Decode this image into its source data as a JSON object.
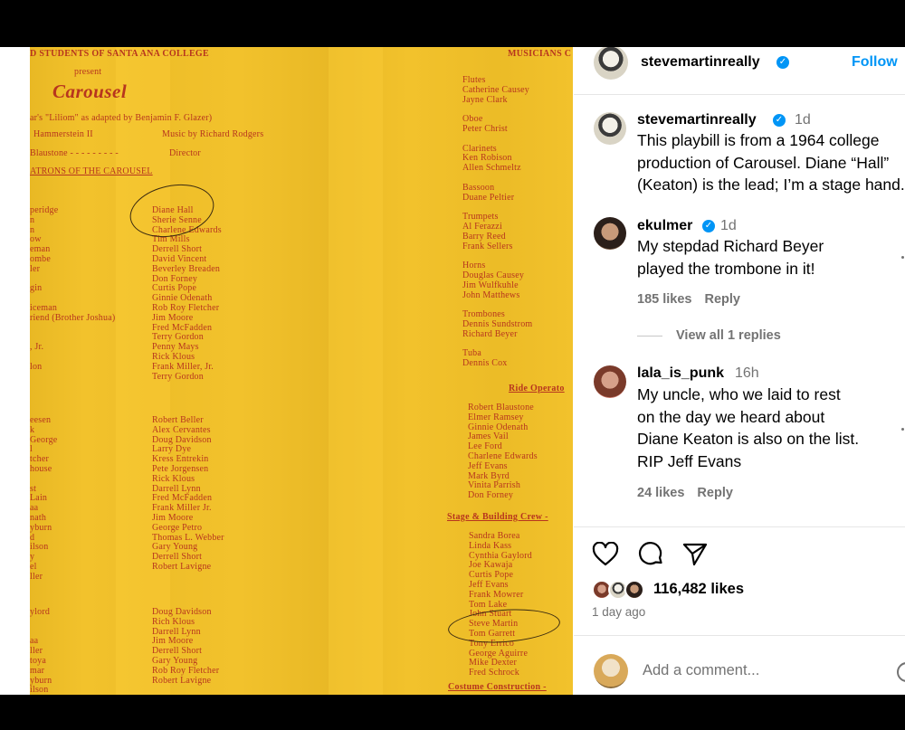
{
  "playbill": {
    "header_left": "D STUDENTS OF SANTA ANA COLLEGE",
    "header_right": "MUSICIANS C",
    "present": "present",
    "title": "Carousel",
    "credit1": "ar's \"Liliom\" as adapted by Benjamin F. Glazer)",
    "credit2a": "Hammerstein II",
    "credit2b": "Music by Richard Rodgers",
    "credit3a": "Blaustone - - - - - - - - -",
    "credit3b": "Director",
    "patrons_heading": "ATRONS OF THE CAROUSEL",
    "roles_left": [
      "peridge",
      "n",
      "n",
      "ow",
      "eman",
      "ombe",
      "ler",
      "",
      "gin",
      "",
      "iceman",
      "riend (Brother Joshua)",
      "",
      "",
      ", Jr.",
      "",
      "lon"
    ],
    "cast1": [
      "Diane Hall",
      "Sherie Senne",
      "Charlene Edwards",
      "Tim Mills",
      "Derrell Short",
      "David Vincent",
      "Beverley Breaden",
      "Don Forney",
      "Curtis Pope",
      "Ginnie Odenath",
      "Rob Roy Fletcher",
      "Jim Moore",
      "Fred McFadden",
      "Terry Gordon",
      "Penny Mays",
      "Rick Klous",
      "Frank Miller, Jr.",
      "Terry Gordon"
    ],
    "roles_left2": [
      "eesen",
      "k",
      "George",
      "l",
      "tcher",
      "house",
      "",
      "st",
      "Lain",
      "aa",
      "nath",
      "yburn",
      "d",
      "ilson",
      "y",
      "el",
      "ller"
    ],
    "cast2": [
      "Robert Beller",
      "Alex Cervantes",
      "Doug Davidson",
      "Larry Dye",
      "Kress Entrekin",
      "Pete Jorgensen",
      "Rick Klous",
      "Darrell Lynn",
      "Fred McFadden",
      "Frank Miller Jr.",
      "Jim Moore",
      "George Petro",
      "Thomas L. Webber",
      "Gary Young",
      "Derrell Short",
      "Robert Lavigne"
    ],
    "roles_left3": [
      "ylord",
      "",
      "",
      "aa",
      "ller",
      "toya",
      "mar",
      "yburn",
      "ilson"
    ],
    "cast3": [
      "Doug Davidson",
      "Rich Klous",
      "Darrell Lynn",
      "Jim Moore",
      "Derrell Short",
      "Gary Young",
      "Rob Roy Fletcher",
      "Robert Lavigne"
    ],
    "musicians": [
      "Flutes",
      "  Catherine Causey",
      "  Jayne Clark",
      "",
      "Oboe",
      "  Peter Christ",
      "",
      "Clarinets",
      "  Ken Robison",
      "  Allen Schmeltz",
      "",
      "Bassoon",
      "  Duane Peltier",
      "",
      "Trumpets",
      "  Al Ferazzi",
      "  Barry Reed",
      "  Frank Sellers",
      "",
      "Horns",
      "  Douglas Causey",
      "  Jim Wulfkuhle",
      "  John Matthews",
      "",
      "Trombones",
      "  Dennis Sundstrom",
      "  Richard Beyer",
      "",
      "Tuba",
      "  Dennis Cox"
    ],
    "ride_heading": "Ride Operato",
    "ride_crew": [
      "Robert Blaustone",
      "Elmer Ramsey",
      "Ginnie Odenath",
      "James Vail",
      "Lee Ford",
      "Charlene Edwards",
      "Jeff Evans",
      "Mark Byrd",
      "Vinita Parrish",
      "Don Forney"
    ],
    "stage_heading": "Stage & Building Crew -",
    "stage_crew": [
      "Sandra Borea",
      "Linda Kass",
      "Cynthia Gaylord",
      "Joe Kawaja",
      "Curtis Pope",
      "Jeff Evans",
      "Frank Mowrer",
      "Tom Lake",
      "John Stuart",
      "Steve Martin",
      "Tom Garrett",
      "Tony Errico",
      "George Aguirre",
      "Mike Dexter",
      "Fred Schrock"
    ],
    "costume_heading": "Costume Construction -"
  },
  "header": {
    "username": "stevemartinreally",
    "follow_label": "Follow"
  },
  "caption": {
    "username": "stevemartinreally",
    "time": "1d",
    "line1": "This playbill is from a 1964 college",
    "line2": "production of Carousel. Diane “Hall”",
    "line3": "(Keaton) is the lead; I’m a stage hand."
  },
  "comments": [
    {
      "username": "ekulmer",
      "time": "1d",
      "line1": "My stepdad Richard Beyer",
      "line2": "played the trombone in it!",
      "likes": "185 likes",
      "reply": "Reply"
    },
    {
      "username": "lala_is_punk",
      "time": "16h",
      "line1": "My uncle, who we laid to rest",
      "line2": "on the day we heard about",
      "line3": "Diane Keaton is also on the list.",
      "line4": "RIP Jeff Evans",
      "likes": "24 likes",
      "reply": "Reply"
    }
  ],
  "view_replies": "View all 1 replies",
  "stats": {
    "likes": "116,482 likes",
    "posted": "1 day ago"
  },
  "add_comment": {
    "placeholder": "Add a comment..."
  },
  "colors": {
    "playbill_bg": "#f2c22c",
    "playbill_ink": "#b7351e",
    "link_blue": "#0095f6",
    "muted": "#737373"
  }
}
